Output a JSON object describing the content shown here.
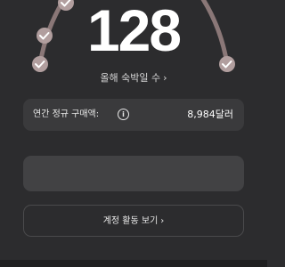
{
  "gauge": {
    "value": "128",
    "caption": "올해 숙박일 수",
    "caption_chevron": "›",
    "milestones_checked": 4,
    "accent_color": "#b19e9e",
    "arc_color": "#8a7777"
  },
  "spend_card": {
    "label": "연간 정규 구매액:",
    "info_icon": "info-icon",
    "value": "8,984달러"
  },
  "account_button": {
    "label": "계정 활동 보기",
    "chevron": "›"
  }
}
